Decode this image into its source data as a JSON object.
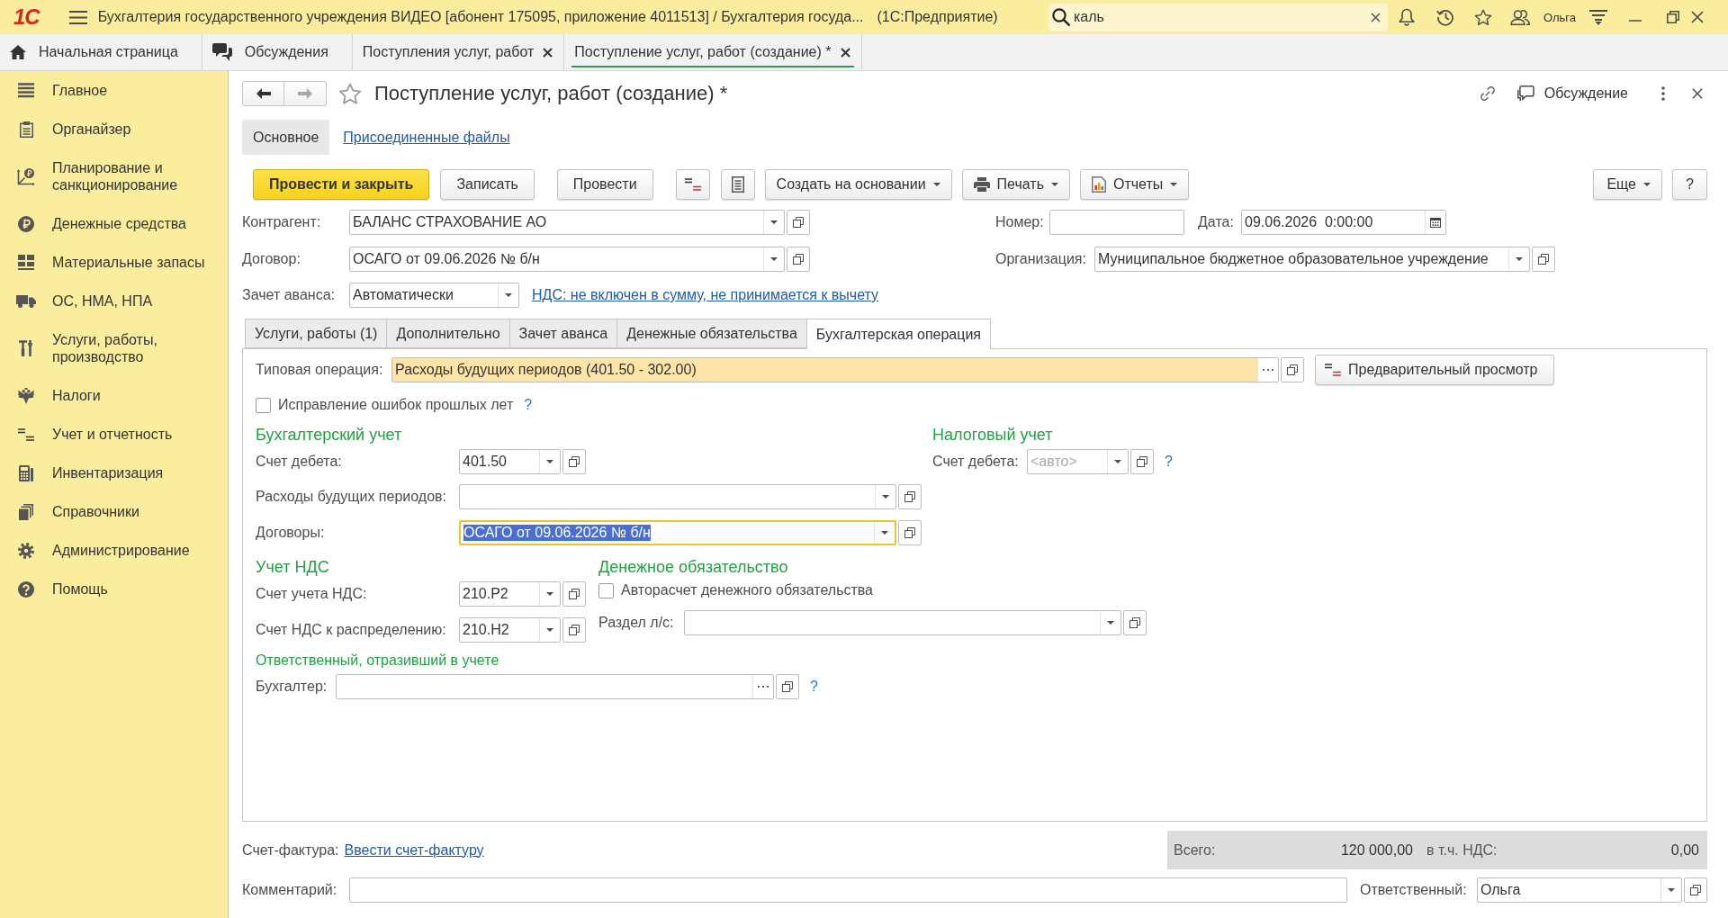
{
  "window": {
    "logo": "1С",
    "title": "Бухгалтерия государственного учреждения ВИДЕО [абонент 175095, приложение 4011513] / Бухгалтерия госуда...",
    "platform": "(1С:Предприятие)",
    "search": {
      "value": "каль"
    },
    "user": "Ольга"
  },
  "open_tabs": [
    {
      "label": "Начальная страница",
      "kind": "home",
      "selected": false
    },
    {
      "label": "Обсуждения",
      "kind": "discussions",
      "selected": false
    },
    {
      "label": "Поступления услуг, работ",
      "kind": "closable",
      "selected": false
    },
    {
      "label": "Поступление услуг, работ (создание) *",
      "kind": "closable",
      "selected": true
    }
  ],
  "sidebar": {
    "items": [
      {
        "label": "Главное"
      },
      {
        "label": "Органайзер"
      },
      {
        "label": "Планирование и санкционирование"
      },
      {
        "label": "Денежные средства"
      },
      {
        "label": "Материальные запасы"
      },
      {
        "label": "ОС, НМА, НПА"
      },
      {
        "label": "Услуги, работы, производство"
      },
      {
        "label": "Налоги"
      },
      {
        "label": "Учет и отчетность"
      },
      {
        "label": "Инвентаризация"
      },
      {
        "label": "Справочники"
      },
      {
        "label": "Администрирование"
      },
      {
        "label": "Помощь"
      }
    ]
  },
  "document": {
    "history_buttons": [
      {
        "kind": "back",
        "disabled": false
      },
      {
        "kind": "forward",
        "disabled": true
      }
    ],
    "title": "Поступление услуг, работ (создание) *",
    "discussion_button": "Обсуждение",
    "sections": [
      {
        "label": "Основное",
        "selected": true
      },
      {
        "label": "Присоединенные файлы",
        "selected": false
      }
    ],
    "toolbar": {
      "actions": [
        {
          "label": "Провести и закрыть",
          "kind": "primary"
        },
        {
          "label": "Записать",
          "kind": "plain"
        },
        {
          "label": "Провести",
          "kind": "plain"
        }
      ],
      "menus": [
        {
          "label": "Создать на основании",
          "kind": "menu"
        },
        {
          "label": "Печать",
          "kind": "print"
        },
        {
          "label": "Отчеты",
          "kind": "reports"
        }
      ],
      "more": "Еще",
      "help": "?"
    },
    "counterparty": {
      "label": "Контрагент:",
      "value": "БАЛАНС СТРАХОВАНИЕ АО"
    },
    "number": {
      "label": "Номер:"
    },
    "date": {
      "label": "Дата:",
      "value": "09.06.2026  0:00:00"
    },
    "contract": {
      "label": "Договор:",
      "value": "ОСАГО от 09.06.2026 № б/н"
    },
    "organization": {
      "label": "Организация:",
      "value": "Муниципальное бюджетное образовательное учреждение"
    },
    "advance_offset": {
      "label": "Зачет аванса:",
      "value": "Автоматически"
    },
    "vat_link": "НДС: не включен в сумму, не принимается к вычету",
    "tabs": [
      {
        "label": "Услуги, работы (1)",
        "selected": false
      },
      {
        "label": "Дополнительно",
        "selected": false
      },
      {
        "label": "Зачет аванса",
        "selected": false
      },
      {
        "label": "Денежные обязательства",
        "selected": false
      },
      {
        "label": "Бухгалтерская операция",
        "selected": true
      }
    ],
    "operation": {
      "typical_operation": {
        "label": "Типовая операция:",
        "value": "Расходы будущих периодов (401.50 - 302.00)",
        "highlighted": true
      },
      "preview_button": "Предварительный просмотр",
      "fix_errors": {
        "label": "Исправление ошибок прошлых лет",
        "checked": false,
        "help": "?"
      },
      "accounting": {
        "title": "Бухгалтерский учет",
        "fields": [
          {
            "label": "Счет дебета:",
            "value": "401.50",
            "focused": false
          },
          {
            "label": "Расходы будущих периодов:",
            "focused": false
          },
          {
            "label": "Договоры:",
            "value": "ОСАГО от 09.06.2026 № б/н",
            "focused": true
          }
        ]
      },
      "tax": {
        "title": "Налоговый учет",
        "debit_account": {
          "label": "Счет дебета:",
          "placeholder": "<авто>",
          "help": "?"
        }
      },
      "vat": {
        "title": "Учет НДС",
        "fields": [
          {
            "label": "Счет учета НДС:",
            "value": "210.Р2"
          },
          {
            "label": "Счет НДС к распределению:",
            "value": "210.Н2"
          }
        ]
      },
      "obligation": {
        "title": "Денежное обязательство",
        "auto_calc": {
          "label": "Авторасчет денежного обязательства",
          "checked": false
        },
        "section": {
          "label": "Раздел л/с:"
        }
      },
      "responsible": {
        "title": "Ответственный, отразивший в учете",
        "accountant": {
          "label": "Бухгалтер:",
          "help": "?"
        }
      }
    },
    "footer": {
      "invoice": {
        "label": "Счет-фактура:",
        "link": "Ввести счет-фактуру"
      },
      "totals": {
        "total_label": "Всего:",
        "total": "120 000,00",
        "vat_label": "в т.ч. НДС:",
        "vat": "0,00"
      },
      "comment": {
        "label": "Комментарий:"
      },
      "responsible": {
        "label": "Ответственный:",
        "value": "Ольга"
      }
    }
  }
}
